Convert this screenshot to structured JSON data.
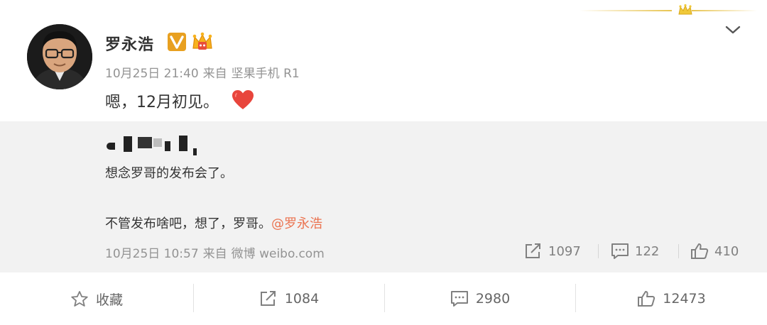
{
  "post": {
    "username": "罗永浩",
    "time": "10月25日 21:40",
    "source_prefix": "来自",
    "source": "坚果手机 R1",
    "text": "嗯，12月初见。"
  },
  "repost": {
    "line1": "想念罗哥的发布会了。",
    "line2_text": "不管发布啥吧，想了，罗哥。",
    "line2_mention": "@罗永浩",
    "time": "10月25日 10:57",
    "source_prefix": "来自",
    "source": "微博 weibo.com",
    "stats": {
      "reposts": "1097",
      "comments": "122",
      "likes": "410"
    }
  },
  "actions": {
    "favorite_label": "收藏",
    "reposts": "1084",
    "comments": "2980",
    "likes": "12473"
  },
  "colors": {
    "mention": "#eb7350",
    "verified_badge": "#e8a020",
    "heart": "#e8453c",
    "repost_bg": "#f2f2f2"
  },
  "icons": {
    "chevron": "chevron-down-icon",
    "favorite": "star-icon",
    "repost": "share-arrow-icon",
    "comment": "comment-icon",
    "like": "thumbs-up-icon",
    "emoji": "red-heart-icon"
  }
}
